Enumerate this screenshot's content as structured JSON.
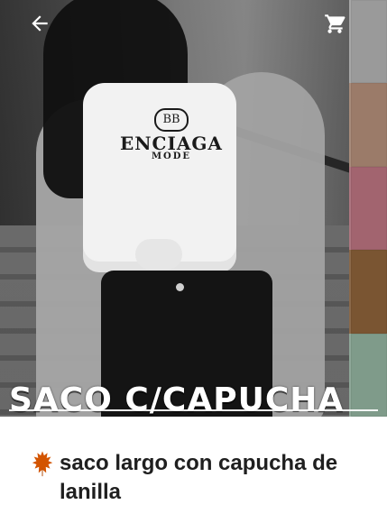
{
  "hero": {
    "banner_text": "SACO C/CAPUCHA",
    "print_text": {
      "logo": "BB",
      "word": "ENCIAGA",
      "sub": "MODE"
    },
    "swatches": [
      {
        "name": "gray",
        "color": "#9a9a9a"
      },
      {
        "name": "taupe",
        "color": "#9b7b69"
      },
      {
        "name": "rose",
        "color": "#a2646f"
      },
      {
        "name": "brown",
        "color": "#7a5532"
      },
      {
        "name": "sage",
        "color": "#7f9b8a"
      }
    ]
  },
  "topbar": {
    "back_icon": "arrow-left-icon",
    "cart_icon": "shopping-cart-icon"
  },
  "product": {
    "title": "saco largo con capucha de lanilla",
    "leading_icon": "maple-leaf-icon",
    "accent_color": "#d35400"
  }
}
